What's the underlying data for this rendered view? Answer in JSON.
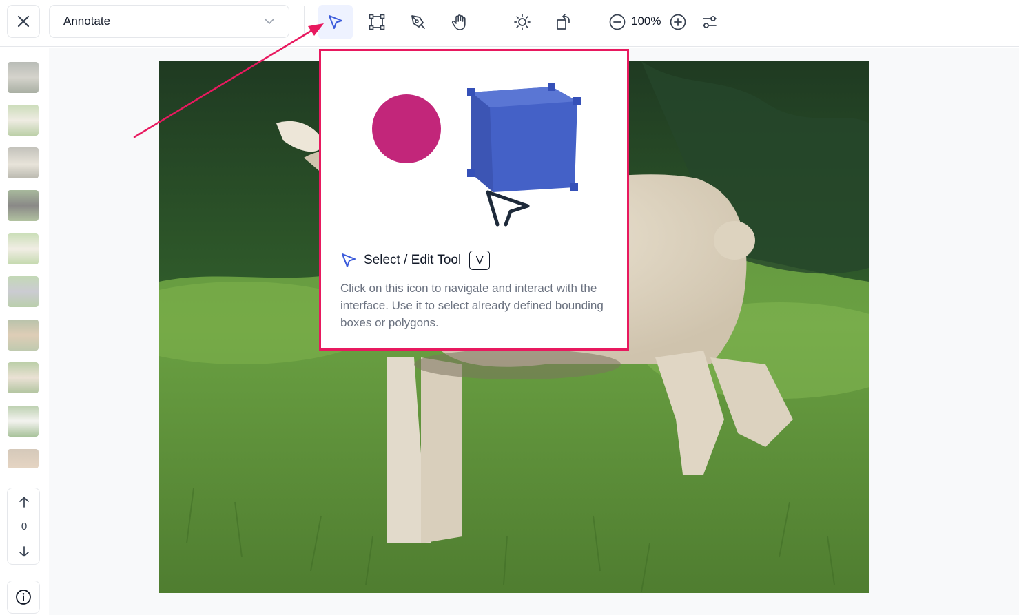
{
  "toolbar": {
    "mode_value": "Annotate",
    "zoom_label": "100%",
    "tools": [
      "select-tool",
      "bounding-box-tool",
      "polygon-pen-tool",
      "pan-hand-tool"
    ],
    "view_tools": [
      "brightness-icon",
      "rotate-icon"
    ],
    "zoom_controls": [
      "zoom-out-icon",
      "zoom-in-icon"
    ],
    "settings_icon": "sliders-icon"
  },
  "sidebar": {
    "thumbnail_count": 10,
    "page_number": "0"
  },
  "tooltip": {
    "title": "Select / Edit Tool",
    "shortcut": "V",
    "description": "Click on this icon to navigate and interact with the interface. Use it to select already defined bounding boxes or polygons."
  },
  "colors": {
    "accent": "#3b5bdb",
    "highlight_border": "#e8195f",
    "illus_circle": "#c2267a",
    "illus_cube": "#4461c7"
  }
}
